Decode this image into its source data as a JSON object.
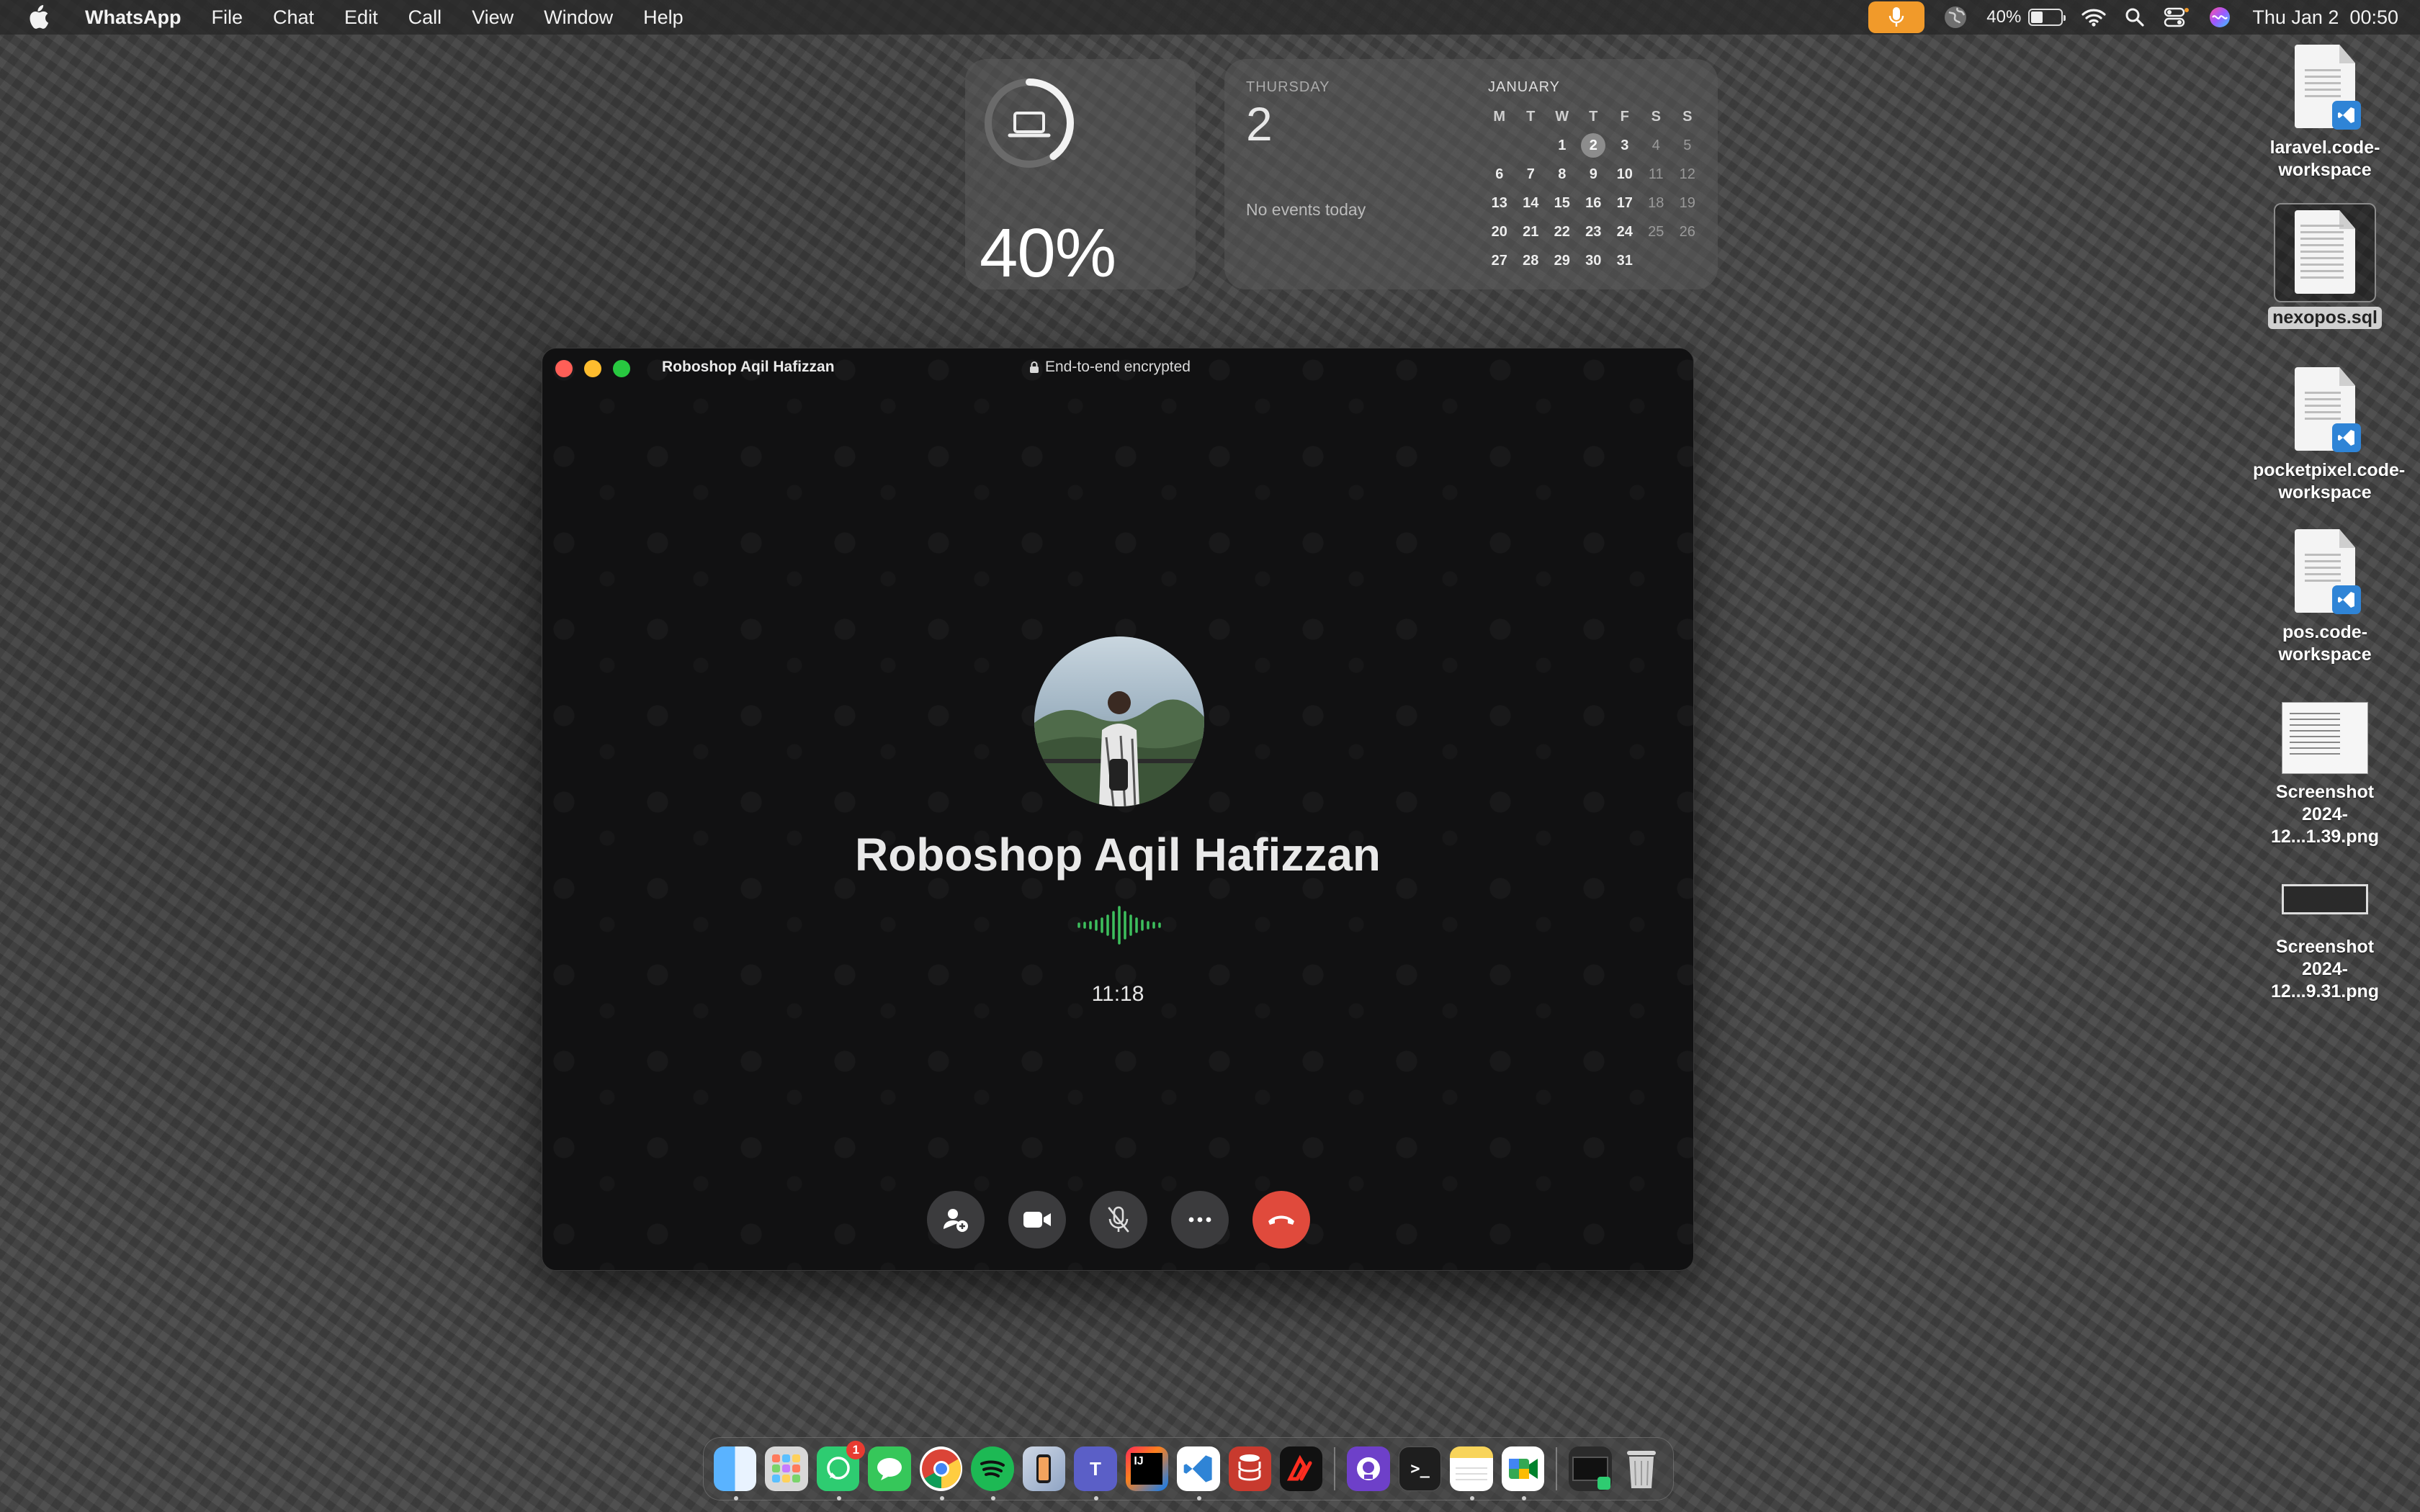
{
  "menubar": {
    "app_name": "WhatsApp",
    "menus": [
      "File",
      "Chat",
      "Edit",
      "Call",
      "View",
      "Window",
      "Help"
    ],
    "battery_percent": "40%",
    "battery_level": 0.4,
    "datetime": "Thu Jan 2  00:50",
    "mic_indicator_color": "#f19a2a"
  },
  "widgets": {
    "battery": {
      "percent": "40%",
      "level": 0.4
    },
    "calendar": {
      "weekday": "THURSDAY",
      "day": "2",
      "events": "No events today",
      "month": "JANUARY",
      "headers": [
        "M",
        "T",
        "W",
        "T",
        "F",
        "S",
        "S"
      ],
      "weeks": [
        [
          "",
          "",
          "1",
          "2",
          "3",
          "4",
          "5"
        ],
        [
          "6",
          "7",
          "8",
          "9",
          "10",
          "11",
          "12"
        ],
        [
          "13",
          "14",
          "15",
          "16",
          "17",
          "18",
          "19"
        ],
        [
          "20",
          "21",
          "22",
          "23",
          "24",
          "25",
          "26"
        ],
        [
          "27",
          "28",
          "29",
          "30",
          "31",
          "",
          ""
        ]
      ],
      "today": "2"
    }
  },
  "desktop_icons": [
    {
      "name": "laravel.code-\nworkspace",
      "line1": "laravel.code-",
      "line2": "workspace",
      "type": "vscode-doc"
    },
    {
      "name": "nexopos.sql",
      "type": "doc",
      "selected": true
    },
    {
      "line1": "pocketpixel.code-",
      "line2": "workspace",
      "type": "vscode-doc"
    },
    {
      "line1": "pos.code-",
      "line2": "workspace",
      "type": "vscode-doc"
    },
    {
      "line1": "Screenshot",
      "line2": "2024-12...1.39.png",
      "type": "screenshot"
    },
    {
      "line1": "Screenshot",
      "line2": "2024-12...9.31.png",
      "type": "screenshot-wide"
    }
  ],
  "call_window": {
    "title": "Roboshop Aqil Hafizzan",
    "encryption": "End-to-end encrypted",
    "contact_name": "Roboshop Aqil Hafizzan",
    "duration": "11:18",
    "accent_green": "#3dbf5d",
    "end_call_color": "#e04a3c",
    "controls": [
      "add-person-icon",
      "video-icon",
      "mic-off-icon",
      "more-icon",
      "end-call-icon"
    ]
  },
  "dock": {
    "apps": [
      "Finder",
      "Launchpad",
      "WhatsApp",
      "Messages",
      "Chrome",
      "Spotify",
      "iPhone Mirroring",
      "Teams",
      "IntelliJ IDEA",
      "VS Code",
      "Database",
      "Laravel",
      "GitHub Desktop",
      "Terminal",
      "Notes",
      "Google Meet",
      "Screen",
      "Trash"
    ],
    "whatsapp_badge": "1"
  }
}
